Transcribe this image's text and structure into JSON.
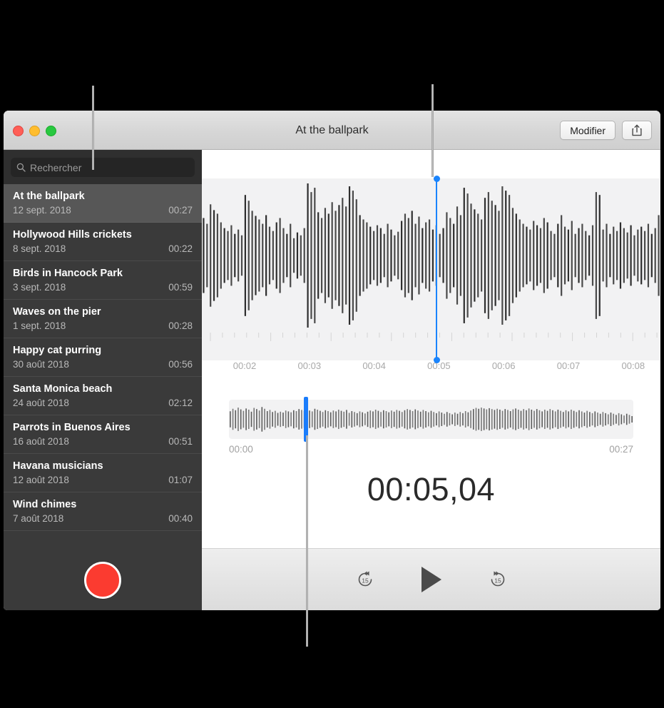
{
  "window": {
    "title": "At the ballpark",
    "traffic_lights": [
      "close-red",
      "minimize-yellow",
      "zoom-green"
    ],
    "toolbar": {
      "edit_label": "Modifier",
      "share_icon": "share-icon"
    }
  },
  "sidebar": {
    "search": {
      "placeholder": "Rechercher",
      "icon": "search-icon",
      "value": ""
    },
    "record_button": {
      "icon": "record-icon",
      "color": "#fb3b30"
    },
    "memos": [
      {
        "title": "At the ballpark",
        "date": "12 sept. 2018",
        "duration": "00:27",
        "selected": true
      },
      {
        "title": "Hollywood Hills crickets",
        "date": "8 sept. 2018",
        "duration": "00:22",
        "selected": false
      },
      {
        "title": "Birds in Hancock Park",
        "date": "3 sept. 2018",
        "duration": "00:59",
        "selected": false
      },
      {
        "title": "Waves on the pier",
        "date": "1 sept. 2018",
        "duration": "00:28",
        "selected": false
      },
      {
        "title": "Happy cat purring",
        "date": "30 août 2018",
        "duration": "00:56",
        "selected": false
      },
      {
        "title": "Santa Monica beach",
        "date": "24 août 2018",
        "duration": "02:12",
        "selected": false
      },
      {
        "title": "Parrots in Buenos Aires",
        "date": "16 août 2018",
        "duration": "00:51",
        "selected": false
      },
      {
        "title": "Havana musicians",
        "date": "12 août 2018",
        "duration": "01:07",
        "selected": false
      },
      {
        "title": "Wind chimes",
        "date": "7 août 2018",
        "duration": "00:40",
        "selected": false
      }
    ]
  },
  "detail": {
    "ruler_labels": [
      "00:02",
      "00:03",
      "00:04",
      "00:05",
      "00:06",
      "00:07",
      "00:08"
    ],
    "playhead_label": "00:05",
    "scrubber": {
      "start_time": "00:00",
      "end_time": "00:27",
      "position_percent": 18.6
    },
    "timecode": "00:05,04",
    "transport": {
      "skip_back_label": "15",
      "skip_back_icon": "skip-back-15-icon",
      "play_icon": "play-icon",
      "skip_forward_label": "15",
      "skip_forward_icon": "skip-forward-15-icon"
    }
  },
  "colors": {
    "accent_blue": "#1a84fc",
    "record_red": "#fb3b30",
    "sidebar_bg": "#3a3a3a",
    "selected_row": "#575757",
    "wave_bg": "#f2f2f3",
    "wave_bar": "#3d3d3d"
  },
  "waveform": {
    "detail_bars": [
      0.52,
      0.44,
      0.71,
      0.63,
      0.58,
      0.46,
      0.38,
      0.34,
      0.42,
      0.3,
      0.36,
      0.28,
      0.84,
      0.76,
      0.62,
      0.55,
      0.5,
      0.44,
      0.56,
      0.4,
      0.34,
      0.46,
      0.52,
      0.38,
      0.3,
      0.44,
      0.24,
      0.32,
      0.28,
      0.38,
      1.0,
      0.88,
      0.94,
      0.6,
      0.52,
      0.66,
      0.58,
      0.74,
      0.62,
      0.7,
      0.8,
      0.68,
      0.96,
      0.9,
      0.78,
      0.56,
      0.5,
      0.46,
      0.4,
      0.34,
      0.42,
      0.38,
      0.3,
      0.44,
      0.36,
      0.28,
      0.33,
      0.48,
      0.58,
      0.52,
      0.62,
      0.44,
      0.54,
      0.38,
      0.46,
      0.5,
      0.36,
      0.42,
      0.3,
      0.38,
      0.6,
      0.52,
      0.44,
      0.68,
      0.56,
      0.94,
      0.86,
      0.72,
      0.64,
      0.58,
      0.5,
      0.8,
      0.88,
      0.76,
      0.7,
      0.62,
      0.96,
      0.9,
      0.84,
      0.66,
      0.58,
      0.5,
      0.44,
      0.4,
      0.36,
      0.48,
      0.42,
      0.38,
      0.52,
      0.46,
      0.34,
      0.3,
      0.44,
      0.56,
      0.4,
      0.36,
      0.48,
      0.3,
      0.38,
      0.44,
      0.34,
      0.28,
      0.42,
      0.88,
      0.84,
      0.36,
      0.44,
      0.3,
      0.4,
      0.34,
      0.46,
      0.38,
      0.32,
      0.42,
      0.28,
      0.36,
      0.4,
      0.34,
      0.44,
      0.3,
      0.38,
      0.56
    ],
    "scrub_bars": [
      0.55,
      0.72,
      0.62,
      0.8,
      0.68,
      0.58,
      0.74,
      0.66,
      0.52,
      0.78,
      0.7,
      0.6,
      0.84,
      0.72,
      0.56,
      0.64,
      0.5,
      0.58,
      0.44,
      0.52,
      0.46,
      0.6,
      0.54,
      0.48,
      0.62,
      0.56,
      0.7,
      0.64,
      0.58,
      0.66,
      0.6,
      0.54,
      0.72,
      0.66,
      0.58,
      0.5,
      0.62,
      0.56,
      0.48,
      0.6,
      0.54,
      0.66,
      0.58,
      0.52,
      0.64,
      0.44,
      0.56,
      0.5,
      0.42,
      0.54,
      0.48,
      0.4,
      0.52,
      0.6,
      0.54,
      0.66,
      0.58,
      0.5,
      0.62,
      0.56,
      0.48,
      0.6,
      0.52,
      0.64,
      0.58,
      0.5,
      0.62,
      0.7,
      0.64,
      0.56,
      0.68,
      0.6,
      0.52,
      0.64,
      0.56,
      0.48,
      0.58,
      0.5,
      0.42,
      0.54,
      0.46,
      0.38,
      0.5,
      0.42,
      0.34,
      0.46,
      0.38,
      0.5,
      0.42,
      0.56,
      0.48,
      0.6,
      0.7,
      0.78,
      0.72,
      0.8,
      0.74,
      0.68,
      0.76,
      0.7,
      0.64,
      0.72,
      0.66,
      0.58,
      0.7,
      0.64,
      0.56,
      0.68,
      0.74,
      0.66,
      0.58,
      0.7,
      0.62,
      0.74,
      0.66,
      0.58,
      0.7,
      0.62,
      0.54,
      0.66,
      0.58,
      0.7,
      0.62,
      0.54,
      0.66,
      0.58,
      0.5,
      0.62,
      0.54,
      0.66,
      0.58,
      0.5,
      0.62,
      0.54,
      0.46,
      0.58,
      0.5,
      0.42,
      0.54,
      0.46,
      0.38,
      0.5,
      0.42,
      0.34,
      0.46,
      0.38,
      0.3,
      0.42,
      0.34,
      0.26,
      0.38,
      0.3,
      0.22
    ]
  }
}
